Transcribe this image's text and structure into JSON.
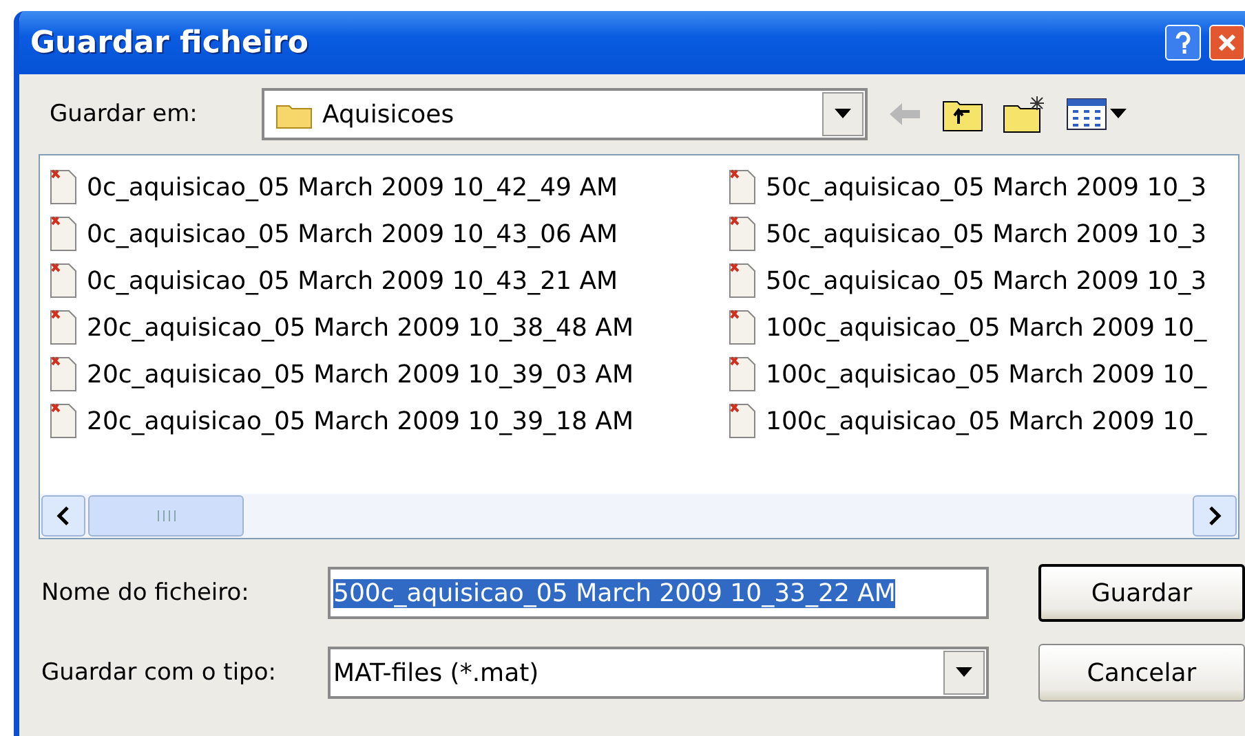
{
  "window": {
    "title": "Guardar ficheiro"
  },
  "save_in": {
    "label": "Guardar em:",
    "value": "Aquisicoes"
  },
  "files": [
    {
      "name": "0c_aquisicao_05 March 2009 10_42_49 AM"
    },
    {
      "name": "0c_aquisicao_05 March 2009 10_43_06 AM"
    },
    {
      "name": "0c_aquisicao_05 March 2009 10_43_21 AM"
    },
    {
      "name": "20c_aquisicao_05 March 2009 10_38_48 AM"
    },
    {
      "name": "20c_aquisicao_05 March 2009 10_39_03 AM"
    },
    {
      "name": "20c_aquisicao_05 March 2009 10_39_18 AM"
    },
    {
      "name": "50c_aquisicao_05 March 2009 10_3"
    },
    {
      "name": "50c_aquisicao_05 March 2009 10_3"
    },
    {
      "name": "50c_aquisicao_05 March 2009 10_3"
    },
    {
      "name": "100c_aquisicao_05 March 2009 10_"
    },
    {
      "name": "100c_aquisicao_05 March 2009 10_"
    },
    {
      "name": "100c_aquisicao_05 March 2009 10_"
    }
  ],
  "filename": {
    "label": "Nome do ficheiro:",
    "value": "500c_aquisicao_05 March 2009 10_33_22 AM"
  },
  "filetype": {
    "label": "Guardar com o tipo:",
    "value": "MAT-files (*.mat)"
  },
  "buttons": [
    {
      "label": "Guardar",
      "default": true
    },
    {
      "label": "Cancelar",
      "default": false
    }
  ]
}
